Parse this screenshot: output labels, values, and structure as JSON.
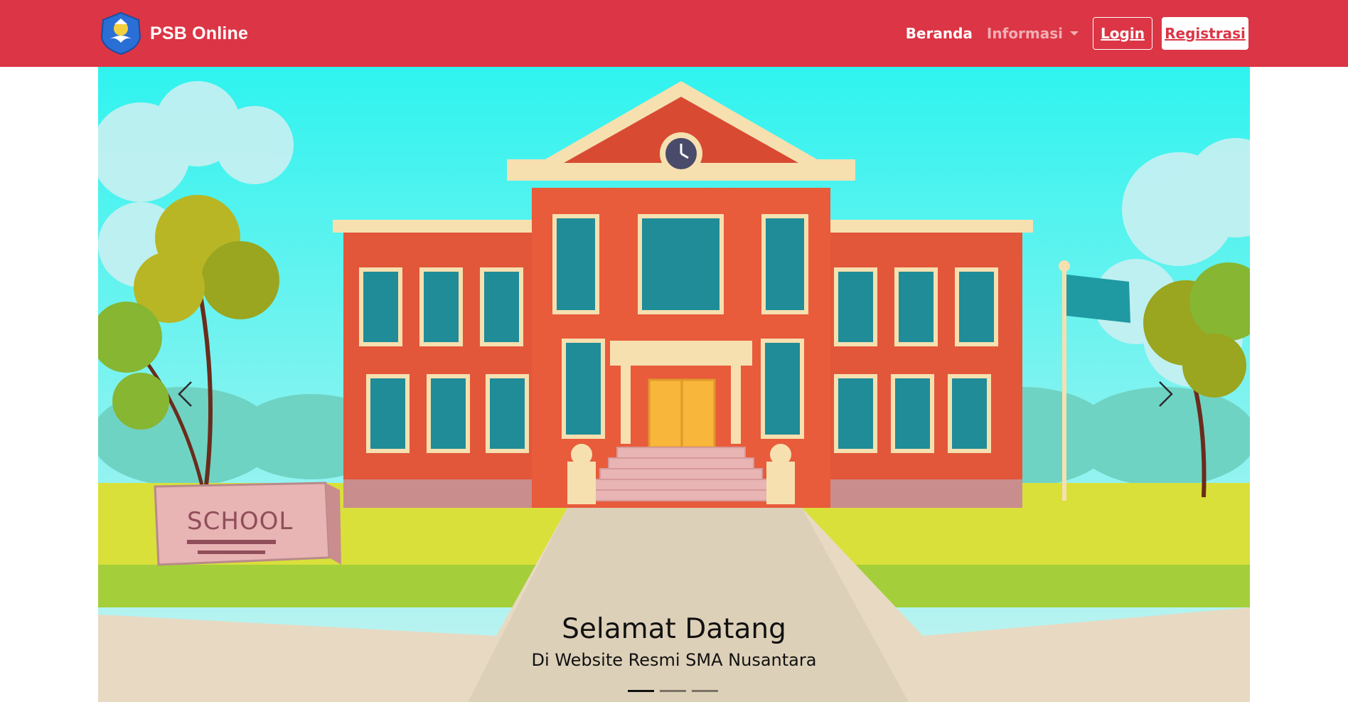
{
  "brand": {
    "name": "PSB Online",
    "logo_icon": "tut-wuri-handayani-logo"
  },
  "nav": {
    "beranda": "Beranda",
    "informasi": "Informasi",
    "login": "Login",
    "registrasi": "Registrasi"
  },
  "carousel": {
    "title": "Selamat Datang",
    "subtitle": "Di Website Resmi SMA Nusantara",
    "sign_text": "SCHOOL",
    "slide_count": 3,
    "active_slide": 1
  },
  "colors": {
    "navbar": "#dc3545",
    "accent_button_text": "#dc3545"
  }
}
